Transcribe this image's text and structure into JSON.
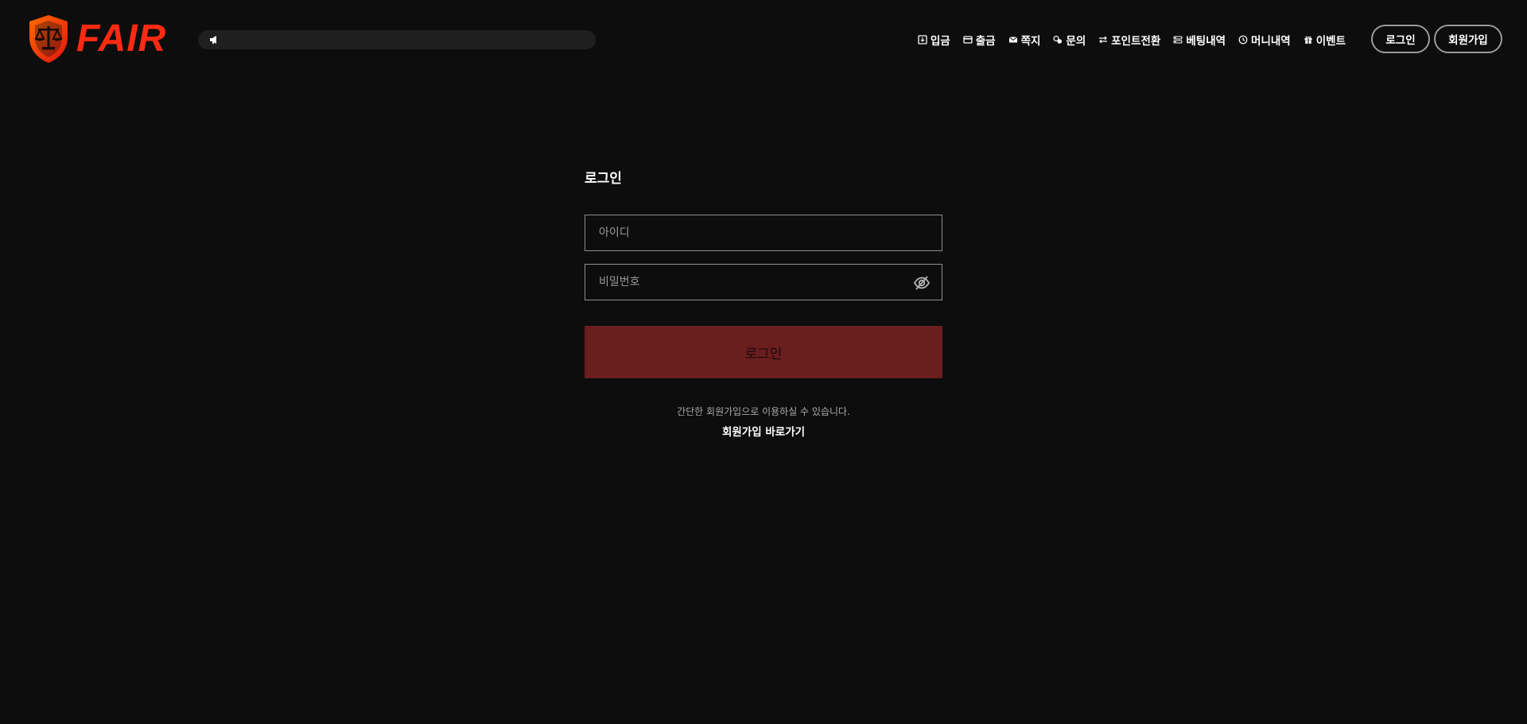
{
  "brand": {
    "name": "FAIR",
    "accent": "#ff2a12",
    "shield_gradient": [
      "#ff6a00",
      "#e3130f"
    ]
  },
  "ticker": {
    "icon": "megaphone-icon",
    "text": ""
  },
  "nav": {
    "items": [
      {
        "label": "입금",
        "icon": "deposit-icon"
      },
      {
        "label": "출금",
        "icon": "withdraw-icon"
      },
      {
        "label": "쪽지",
        "icon": "mail-icon"
      },
      {
        "label": "문의",
        "icon": "inquiry-icon"
      },
      {
        "label": "포인트전환",
        "icon": "exchange-icon"
      },
      {
        "label": "베팅내역",
        "icon": "list-icon"
      },
      {
        "label": "머니내역",
        "icon": "clock-icon"
      },
      {
        "label": "이벤트",
        "icon": "gift-icon"
      }
    ],
    "login_label": "로그인",
    "signup_label": "회원가입"
  },
  "login": {
    "title": "로그인",
    "id_placeholder": "아이디",
    "password_placeholder": "비밀번호",
    "password_toggle_icon": "eye-slash-icon",
    "submit_label": "로그인",
    "submit_color": "#6a1e1e",
    "signup_hint": "간단한 회원가입으로 이용하실 수 있습니다.",
    "signup_link": "회원가입 바로가기"
  }
}
